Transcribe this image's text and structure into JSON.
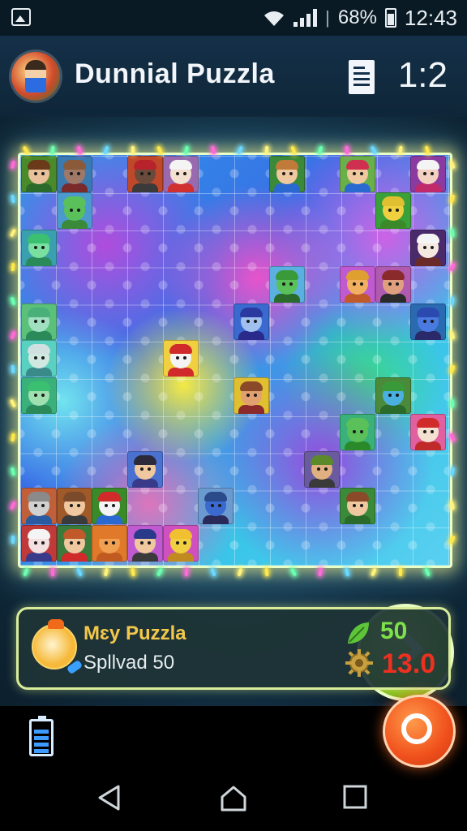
{
  "status_bar": {
    "battery": "68%",
    "time": "12:43"
  },
  "header": {
    "title": "Dunnial  Puzzla",
    "level": "1:2"
  },
  "board": {
    "columns": 12,
    "rows": 11
  },
  "next_button": {
    "icon": "chevron-right-icon"
  },
  "info_panel": {
    "name": "Mɛy Puzzla",
    "subtitle": "Spllvad 50",
    "score": "50",
    "time": "13.0",
    "score_icon": "leaf-icon",
    "time_icon": "gear-icon"
  },
  "colors": {
    "accent_green": "#8fce1c",
    "score_green": "#7ee04a",
    "time_red": "#ee3020",
    "title_gold": "#f3c84a",
    "record_orange": "#f0501c"
  },
  "nav": {
    "back": "back-icon",
    "home": "home-icon",
    "recents": "recents-icon"
  }
}
